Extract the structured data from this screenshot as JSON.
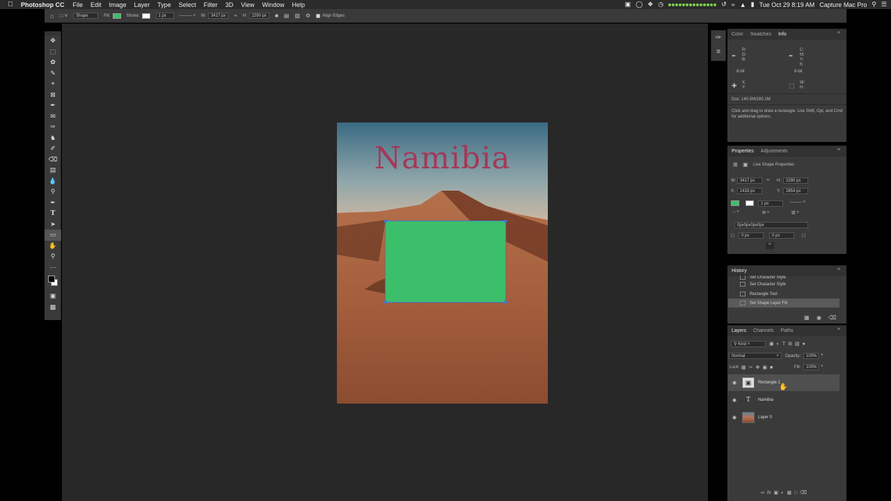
{
  "menubar": {
    "app_name": "Photoshop CC",
    "menus": [
      "File",
      "Edit",
      "Image",
      "Layer",
      "Type",
      "Select",
      "Filter",
      "3D",
      "View",
      "Window",
      "Help"
    ],
    "clock": "Tue Oct 29  8:19 AM",
    "user": "Capture Mac Pro"
  },
  "options_bar": {
    "mode_label": "Shape",
    "fill_label": "Fill:",
    "stroke_label": "Stroke:",
    "stroke_width": "1 px",
    "w_label": "W:",
    "w_value": "3417 px",
    "h_label": "H:",
    "h_value": "2290 px",
    "align_edges_label": "Align Edges",
    "fill_color": "#3cbf6b"
  },
  "document": {
    "title_text": "Namibia",
    "shape_color": "#3cbf6b"
  },
  "info_panel": {
    "tabs": [
      "Color",
      "Swatches",
      "Info"
    ],
    "active_tab": "Info",
    "rgb_labels": "R:\nG:\nB:",
    "cmyk_labels": "C:\nM:\nY:\nK:",
    "bit_left": "8-bit",
    "bit_right": "8-bit",
    "x_label": "X:",
    "y_label": "Y:",
    "w_label": "W:",
    "h_label": "H:",
    "doc_size": "Doc: 140.5M/160.1M",
    "hint": "Click and drag to draw a rectangle.  Use Shift, Opt, and Cmd for additional options."
  },
  "properties_panel": {
    "tabs": [
      "Properties",
      "Adjustments"
    ],
    "section_title": "Live Shape Properties",
    "w_value": "3417 px",
    "h_value": "2290 px",
    "x_value": "1418 px",
    "y_value": "2854 px",
    "stroke_width": "1 px",
    "radius_text": "0px0px0px0px",
    "radius_left": "0 px",
    "radius_right": "0 px",
    "w_label": "W:",
    "h_label": "H:",
    "x_label": "X:",
    "y_label": "Y:"
  },
  "history_panel": {
    "title": "History",
    "items": [
      "Set Character Style",
      "Set Character Style",
      "Rectangle Tool",
      "Set Shape Layer Fill"
    ],
    "selected_index": 3
  },
  "layers_panel": {
    "tabs": [
      "Layers",
      "Channels",
      "Paths"
    ],
    "kind_label": "Kind",
    "blend_mode": "Normal",
    "opacity_label": "Opacity:",
    "opacity_value": "100%",
    "lock_label": "Lock:",
    "fill_label": "Fill:",
    "fill_value": "100%",
    "layers": [
      {
        "name": "Rectangle 1",
        "type": "shape",
        "selected": true
      },
      {
        "name": "Namibia",
        "type": "text",
        "selected": false
      },
      {
        "name": "Layer 0",
        "type": "image",
        "selected": false
      }
    ]
  }
}
